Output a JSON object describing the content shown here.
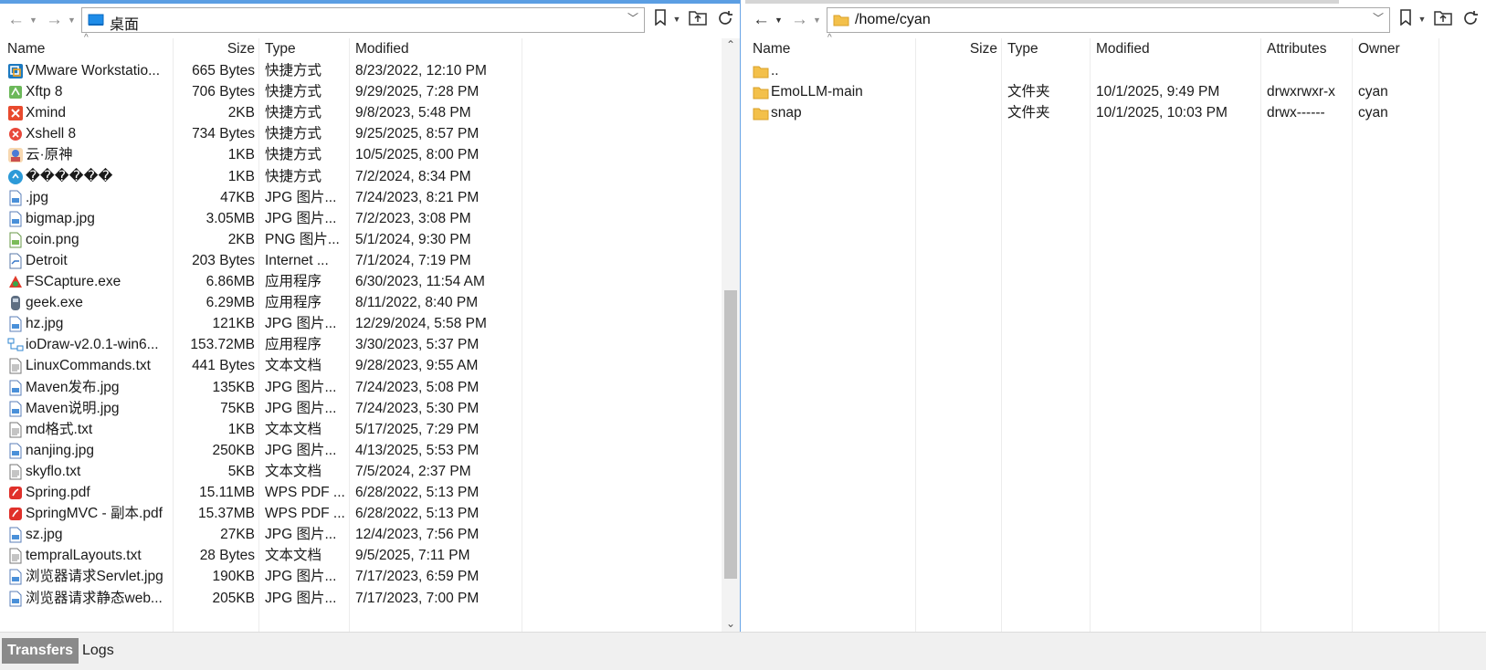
{
  "left": {
    "path": "桌面",
    "columns": [
      "Name",
      "Size",
      "Type",
      "Modified"
    ],
    "rows": [
      {
        "icon": "vmware-icon",
        "name": "VMware Workstatio...",
        "size": "665 Bytes",
        "type": "快捷方式",
        "modified": "8/23/2022, 12:10 PM"
      },
      {
        "icon": "xftp-icon",
        "name": "Xftp 8",
        "size": "706 Bytes",
        "type": "快捷方式",
        "modified": "9/29/2025, 7:28 PM"
      },
      {
        "icon": "xmind-icon",
        "name": "Xmind",
        "size": "2KB",
        "type": "快捷方式",
        "modified": "9/8/2023, 5:48 PM"
      },
      {
        "icon": "xshell-icon",
        "name": "Xshell 8",
        "size": "734 Bytes",
        "type": "快捷方式",
        "modified": "9/25/2025, 8:57 PM"
      },
      {
        "icon": "genshin-icon",
        "name": "云·原神",
        "size": "1KB",
        "type": "快捷方式",
        "modified": "10/5/2025, 8:00 PM"
      },
      {
        "icon": "app-shortcut-icon",
        "name": "������",
        "size": "1KB",
        "type": "快捷方式",
        "modified": "7/2/2024, 8:34 PM"
      },
      {
        "icon": "image-file-icon",
        "name": ".jpg",
        "size": "47KB",
        "type": "JPG 图片...",
        "modified": "7/24/2023, 8:21 PM"
      },
      {
        "icon": "image-file-icon",
        "name": "bigmap.jpg",
        "size": "3.05MB",
        "type": "JPG 图片...",
        "modified": "7/2/2023, 3:08 PM"
      },
      {
        "icon": "png-file-icon",
        "name": "coin.png",
        "size": "2KB",
        "type": "PNG 图片...",
        "modified": "5/1/2024, 9:30 PM"
      },
      {
        "icon": "internet-shortcut-icon",
        "name": "Detroit",
        "size": "203 Bytes",
        "type": "Internet ...",
        "modified": "7/1/2024, 7:19 PM"
      },
      {
        "icon": "fscapture-icon",
        "name": "FSCapture.exe",
        "size": "6.86MB",
        "type": "应用程序",
        "modified": "6/30/2023, 11:54 AM"
      },
      {
        "icon": "geek-icon",
        "name": "geek.exe",
        "size": "6.29MB",
        "type": "应用程序",
        "modified": "8/11/2022, 8:40 PM"
      },
      {
        "icon": "image-file-icon",
        "name": "hz.jpg",
        "size": "121KB",
        "type": "JPG 图片...",
        "modified": "12/29/2024, 5:58 PM"
      },
      {
        "icon": "iodraw-icon",
        "name": "ioDraw-v2.0.1-win6...",
        "size": "153.72MB",
        "type": "应用程序",
        "modified": "3/30/2023, 5:37 PM"
      },
      {
        "icon": "text-file-icon",
        "name": "LinuxCommands.txt",
        "size": "441 Bytes",
        "type": "文本文档",
        "modified": "9/28/2023, 9:55 AM"
      },
      {
        "icon": "image-file-icon",
        "name": "Maven发布.jpg",
        "size": "135KB",
        "type": "JPG 图片...",
        "modified": "7/24/2023, 5:08 PM"
      },
      {
        "icon": "image-file-icon",
        "name": "Maven说明.jpg",
        "size": "75KB",
        "type": "JPG 图片...",
        "modified": "7/24/2023, 5:30 PM"
      },
      {
        "icon": "text-file-icon",
        "name": "md格式.txt",
        "size": "1KB",
        "type": "文本文档",
        "modified": "5/17/2025, 7:29 PM"
      },
      {
        "icon": "image-file-icon",
        "name": "nanjing.jpg",
        "size": "250KB",
        "type": "JPG 图片...",
        "modified": "4/13/2025, 5:53 PM"
      },
      {
        "icon": "text-file-icon",
        "name": "skyflo.txt",
        "size": "5KB",
        "type": "文本文档",
        "modified": "7/5/2024, 2:37 PM"
      },
      {
        "icon": "pdf-file-icon",
        "name": "Spring.pdf",
        "size": "15.11MB",
        "type": "WPS PDF ...",
        "modified": "6/28/2022, 5:13 PM"
      },
      {
        "icon": "pdf-file-icon",
        "name": "SpringMVC - 副本.pdf",
        "size": "15.37MB",
        "type": "WPS PDF ...",
        "modified": "6/28/2022, 5:13 PM"
      },
      {
        "icon": "image-file-icon",
        "name": "sz.jpg",
        "size": "27KB",
        "type": "JPG 图片...",
        "modified": "12/4/2023, 7:56 PM"
      },
      {
        "icon": "text-file-icon",
        "name": "tempralLayouts.txt",
        "size": "28 Bytes",
        "type": "文本文档",
        "modified": "9/5/2025, 7:11 PM"
      },
      {
        "icon": "image-file-icon",
        "name": "浏览器请求Servlet.jpg",
        "size": "190KB",
        "type": "JPG 图片...",
        "modified": "7/17/2023, 6:59 PM"
      },
      {
        "icon": "image-file-icon",
        "name": "浏览器请求静态web...",
        "size": "205KB",
        "type": "JPG 图片...",
        "modified": "7/17/2023, 7:00 PM"
      }
    ]
  },
  "right": {
    "path": "/home/cyan",
    "columns": [
      "Name",
      "Size",
      "Type",
      "Modified",
      "Attributes",
      "Owner"
    ],
    "rows": [
      {
        "icon": "folder-icon",
        "name": "..",
        "size": "",
        "type": "",
        "modified": "",
        "attributes": "",
        "owner": ""
      },
      {
        "icon": "folder-icon",
        "name": "EmoLLM-main",
        "size": "",
        "type": "文件夹",
        "modified": "10/1/2025, 9:49 PM",
        "attributes": "drwxrwxr-x",
        "owner": "cyan"
      },
      {
        "icon": "folder-icon",
        "name": "snap",
        "size": "",
        "type": "文件夹",
        "modified": "10/1/2025, 10:03 PM",
        "attributes": "drwx------",
        "owner": "cyan"
      }
    ]
  },
  "bottom_tabs": [
    {
      "label": "Transfers",
      "active": true
    },
    {
      "label": "Logs",
      "active": false
    }
  ],
  "colors": {
    "accent": "#5b9ee3",
    "folder": "#f3c04a",
    "pdf": "#e0302a"
  }
}
